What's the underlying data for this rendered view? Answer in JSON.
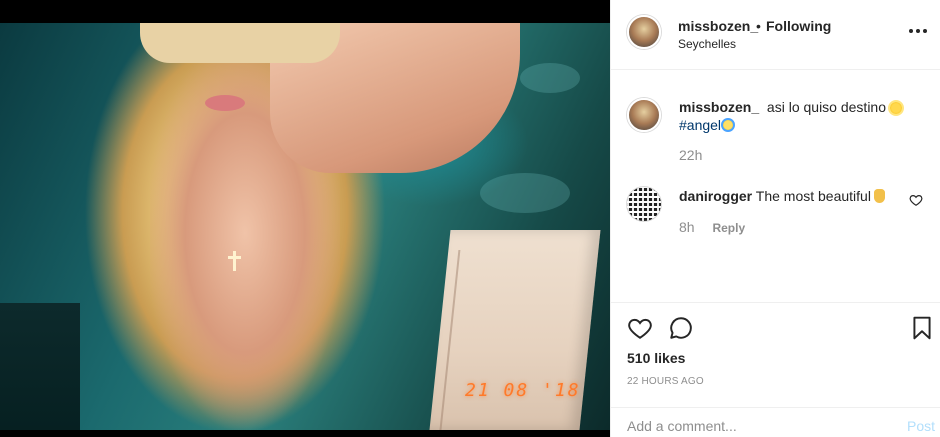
{
  "post": {
    "username": "missbozen_",
    "separator": "•",
    "follow_status": "Following",
    "location": "Seychelles",
    "photo_date_stamp": "21 08 '18"
  },
  "caption": {
    "username": "missbozen_",
    "text": "asi lo quiso destino",
    "hashtag": "#angel",
    "time": "22h"
  },
  "comments": [
    {
      "username": "danirogger",
      "text": "The most beautiful",
      "time": "8h",
      "reply_label": "Reply"
    }
  ],
  "actions": {
    "likes": "510 likes",
    "time_ago": "22 HOURS AGO"
  },
  "add_comment": {
    "placeholder": "Add a comment...",
    "post_label": "Post"
  },
  "icons": {
    "more": "more-options-icon",
    "like": "heart-icon",
    "comment": "comment-icon",
    "save": "bookmark-icon"
  },
  "colors": {
    "text": "#262626",
    "muted": "#8e8e8e",
    "hashtag": "#00376b",
    "post_disabled": "#b2dffc"
  }
}
